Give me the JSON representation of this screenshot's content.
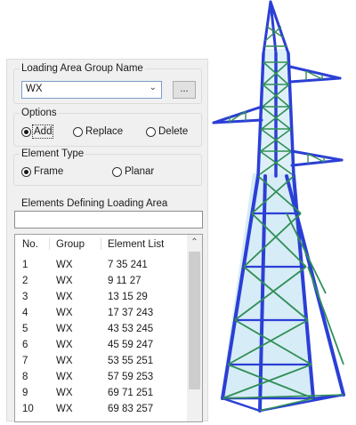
{
  "loading_area": {
    "label": "Loading Area Group Name",
    "selected": "WX",
    "browse_label": "..."
  },
  "options": {
    "label": "Options",
    "add": "Add",
    "replace": "Replace",
    "delete": "Delete",
    "selected": "Add"
  },
  "element_type": {
    "label": "Element Type",
    "frame": "Frame",
    "planar": "Planar",
    "selected": "Frame"
  },
  "elements_defining": {
    "label": "Elements Defining Loading Area",
    "value": ""
  },
  "table": {
    "headers": [
      "No.",
      "Group",
      "Element List"
    ],
    "rows": [
      [
        "1",
        "WX",
        "7 35 241"
      ],
      [
        "2",
        "WX",
        "9 11 27"
      ],
      [
        "3",
        "WX",
        "13 15 29"
      ],
      [
        "4",
        "WX",
        "17 37 243"
      ],
      [
        "5",
        "WX",
        "43 53 245"
      ],
      [
        "6",
        "WX",
        "45 59 247"
      ],
      [
        "7",
        "WX",
        "53 55 251"
      ],
      [
        "8",
        "WX",
        "57 59 253"
      ],
      [
        "9",
        "WX",
        "69 71 251"
      ],
      [
        "10",
        "WX",
        "69 83 257"
      ]
    ]
  },
  "icons": {
    "dropdown": "chevron-down-icon",
    "scroll_up": "scroll-up-arrow-icon"
  },
  "colors": {
    "member_blue": "#2b3fd6",
    "member_green": "#2f8f55",
    "tower_fill": "#cfe9f4"
  }
}
